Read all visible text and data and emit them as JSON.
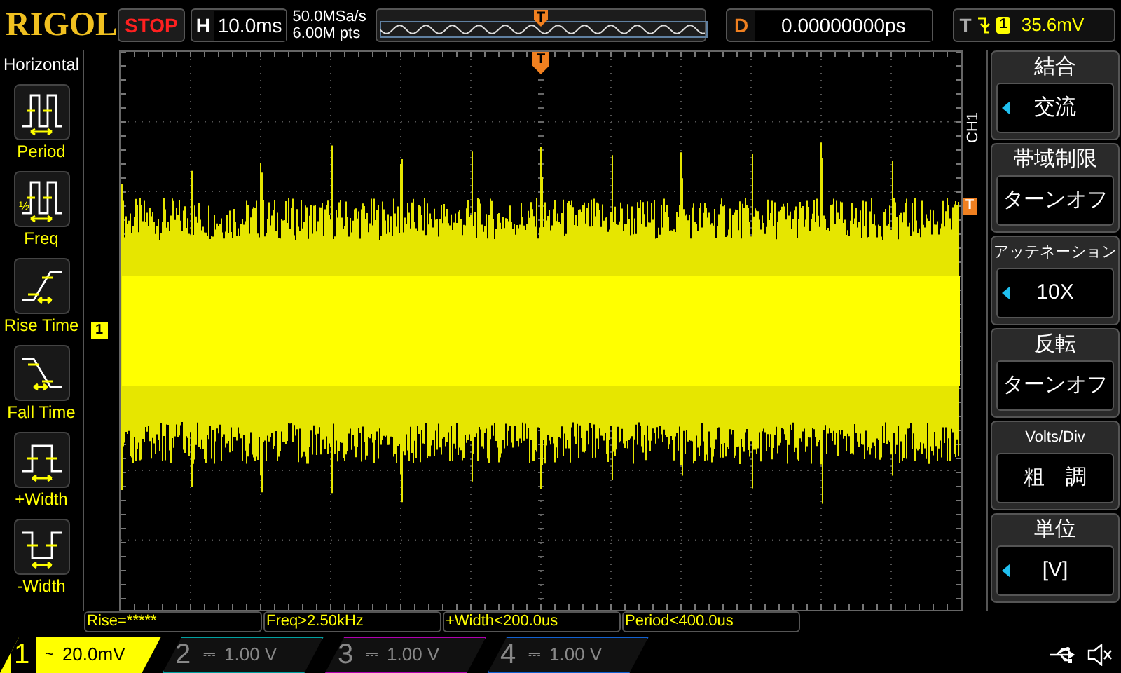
{
  "top_bar": {
    "brand": "RIGOL",
    "run_state": "STOP",
    "horizontal": {
      "label": "H",
      "timebase": "10.0ms"
    },
    "sample_rate": "50.0MSa/s",
    "memory_depth": "6.00M pts",
    "delay": {
      "label": "D",
      "value": "0.00000000ps"
    },
    "trigger": {
      "label": "T",
      "source": "1",
      "level": "35.6mV"
    }
  },
  "left_menu": {
    "title": "Horizontal",
    "items": [
      {
        "kind": "period",
        "label": "Period"
      },
      {
        "kind": "freq",
        "label": "Freq",
        "icon_text": "½"
      },
      {
        "kind": "rise",
        "label": "Rise Time"
      },
      {
        "kind": "fall",
        "label": "Fall Time"
      },
      {
        "kind": "pwidth",
        "label": "+Width"
      },
      {
        "kind": "nwidth",
        "label": "-Width"
      }
    ]
  },
  "plot": {
    "trigger_marker_top": "T",
    "trigger_marker_right": "T",
    "channel_marker": "1"
  },
  "right_menu": {
    "channel_label": "CH1",
    "items": [
      {
        "title": "結合",
        "value": "交流",
        "arrow": true
      },
      {
        "title": "帯域制限",
        "value": "ターンオフ",
        "arrow": false
      },
      {
        "title": "アッテネーション",
        "value": "10X",
        "arrow": true
      },
      {
        "title": "反転",
        "value": "ターンオフ",
        "arrow": false
      },
      {
        "title": "Volts/Div",
        "value": "粗　調",
        "arrow": false
      },
      {
        "title": "単位",
        "value": "[V]",
        "arrow": true
      }
    ]
  },
  "measurements": [
    "Rise=*****",
    "Freq>2.50kHz",
    "+Width<200.0us",
    "Period<400.0us"
  ],
  "channels": [
    {
      "number": "1",
      "coupling": "~",
      "scale": "20.0mV",
      "on": true,
      "color": "#ffff00"
    },
    {
      "number": "2",
      "coupling": "⎓",
      "scale": "1.00 V",
      "on": false,
      "color": "#00a0a0"
    },
    {
      "number": "3",
      "coupling": "⎓",
      "scale": "1.00 V",
      "on": false,
      "color": "#b000b0"
    },
    {
      "number": "4",
      "coupling": "⎓",
      "scale": "1.00 V",
      "on": false,
      "color": "#1060d0"
    }
  ]
}
